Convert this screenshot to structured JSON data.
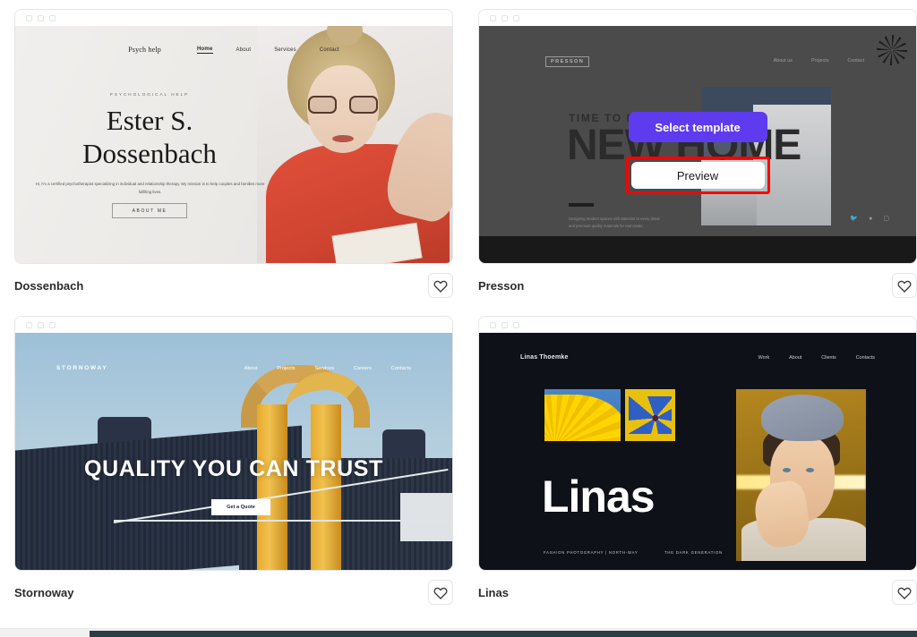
{
  "templates": [
    {
      "name": "Dossenbach",
      "favorite_icon": "heart-icon",
      "preview": {
        "brand": "Psych help",
        "nav": [
          "Home",
          "About",
          "Services",
          "Contact"
        ],
        "kicker": "PSYCHOLOGICAL HELP",
        "title_line1": "Ester S.",
        "title_line2": "Dossenbach",
        "body": "Hi, I'm a certified psychotherapist specializing in individual and relationship therapy. My mission is to help couples and families more fulfilling lives.",
        "button": "ABOUT ME"
      }
    },
    {
      "name": "Presson",
      "favorite_icon": "heart-icon",
      "preview": {
        "brand": "PRESSON",
        "nav": [
          "About us",
          "Projects",
          "Contact"
        ],
        "headline_small": "TIME TO MEET YOUR",
        "headline_big": "NEW HOME",
        "body": "Designing modern spaces with attention to every detail and premium quality materials for real estate.",
        "social": [
          "twitter-icon",
          "facebook-icon",
          "instagram-icon"
        ]
      },
      "hover_actions": {
        "select_label": "Select template",
        "preview_label": "Preview",
        "highlighted": "preview"
      }
    },
    {
      "name": "Stornoway",
      "favorite_icon": "heart-icon",
      "preview": {
        "brand": "STORNOWAY",
        "nav": [
          "About",
          "Projects",
          "Services",
          "Careers",
          "Contacts"
        ],
        "headline": "QUALITY YOU CAN TRUST",
        "button": "Get a Quote"
      }
    },
    {
      "name": "Linas",
      "favorite_icon": "heart-icon",
      "preview": {
        "brand": "Linas Thoemke",
        "nav": [
          "Work",
          "About",
          "Clients",
          "Contacts"
        ],
        "headline": "Linas",
        "caption_left": "FASHION PHOTOGRAPHY | NORTH-WAY",
        "caption_right": "THE DARK GENERATION"
      }
    }
  ],
  "colors": {
    "accent_purple": "#5e3bee",
    "highlight_red": "#ff0000",
    "label_text": "#2b2b2b",
    "card_border": "#e4e6e8"
  }
}
